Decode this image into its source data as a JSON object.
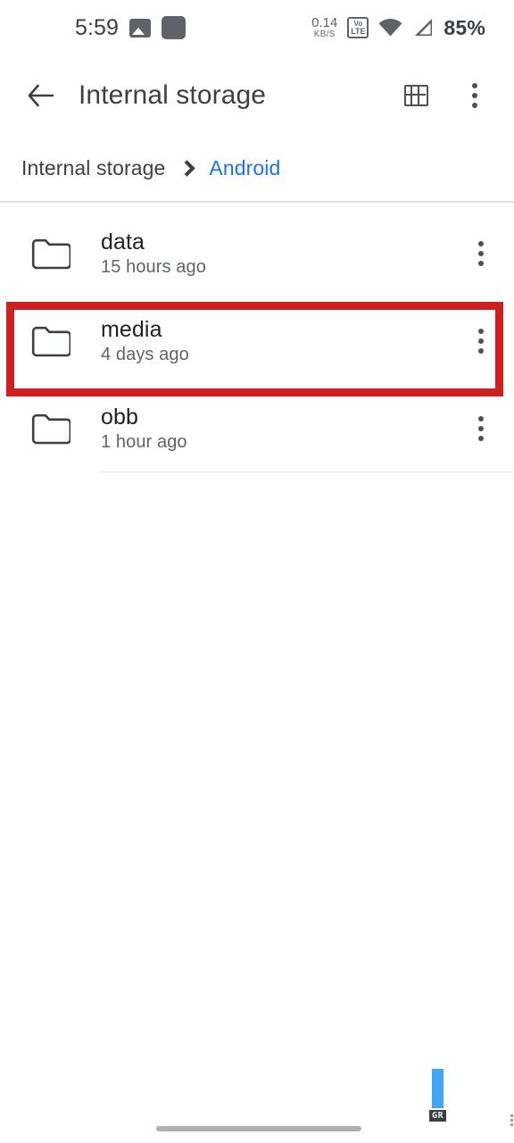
{
  "status_bar": {
    "time": "5:59",
    "icons_left": [
      "photo-icon",
      "app-square-icon"
    ],
    "net_speed_value": "0.14",
    "net_speed_unit": "KB/S",
    "volte_top": "Vo",
    "volte_bottom": "LTE",
    "icons_right": [
      "volte-icon",
      "wifi-icon",
      "cellular-signal-icon"
    ],
    "battery": "85%"
  },
  "app_bar": {
    "back_icon": "back-arrow-icon",
    "title": "Internal storage",
    "grid_icon": "grid-view-icon",
    "overflow_icon": "overflow-menu-icon"
  },
  "breadcrumb": {
    "root": "Internal storage",
    "separator_icon": "chevron-right-icon",
    "current": "Android",
    "current_color": "#1a73e8"
  },
  "file_list": {
    "items": [
      {
        "icon": "folder-icon",
        "name": "data",
        "modified": "15 hours ago",
        "menu_icon": "overflow-menu-icon",
        "highlighted": false
      },
      {
        "icon": "folder-icon",
        "name": "media",
        "modified": "4 days ago",
        "menu_icon": "overflow-menu-icon",
        "highlighted": true
      },
      {
        "icon": "folder-icon",
        "name": "obb",
        "modified": "1 hour ago",
        "menu_icon": "overflow-menu-icon",
        "highlighted": false
      }
    ]
  },
  "annotation": {
    "target": "media",
    "color": "#d01f1f",
    "shape": "rectangle"
  },
  "overlay": {
    "bar_color": "#42a5f5",
    "tag_label": "GR"
  },
  "navigation": {
    "home_indicator": "home-indicator"
  }
}
